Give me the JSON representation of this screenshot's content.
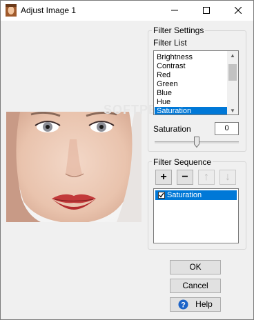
{
  "window": {
    "title": "Adjust Image 1",
    "minimize_glyph": "—",
    "maximize_glyph": "□",
    "close_glyph": "✕"
  },
  "filter_settings": {
    "group_title": "Filter Settings",
    "list_label": "Filter List",
    "items": [
      "Brightness",
      "Contrast",
      "Red",
      "Green",
      "Blue",
      "Hue",
      "Saturation"
    ],
    "selected": "Saturation",
    "value_label": "Saturation",
    "value": "0"
  },
  "filter_sequence": {
    "group_title": "Filter Sequence",
    "add_glyph": "+",
    "remove_glyph": "−",
    "up_glyph": "↑",
    "down_glyph": "↓",
    "items": [
      "Saturation"
    ]
  },
  "buttons": {
    "ok": "OK",
    "cancel": "Cancel",
    "help": "Help"
  },
  "watermark": "SOFTPEDIA",
  "colors": {
    "selection": "#0078d7",
    "window_bg": "#f0f0f0"
  },
  "icons": [
    "app-icon",
    "help-icon",
    "add-icon",
    "remove-icon",
    "up-arrow-icon",
    "down-arrow-icon",
    "check-icon"
  ]
}
